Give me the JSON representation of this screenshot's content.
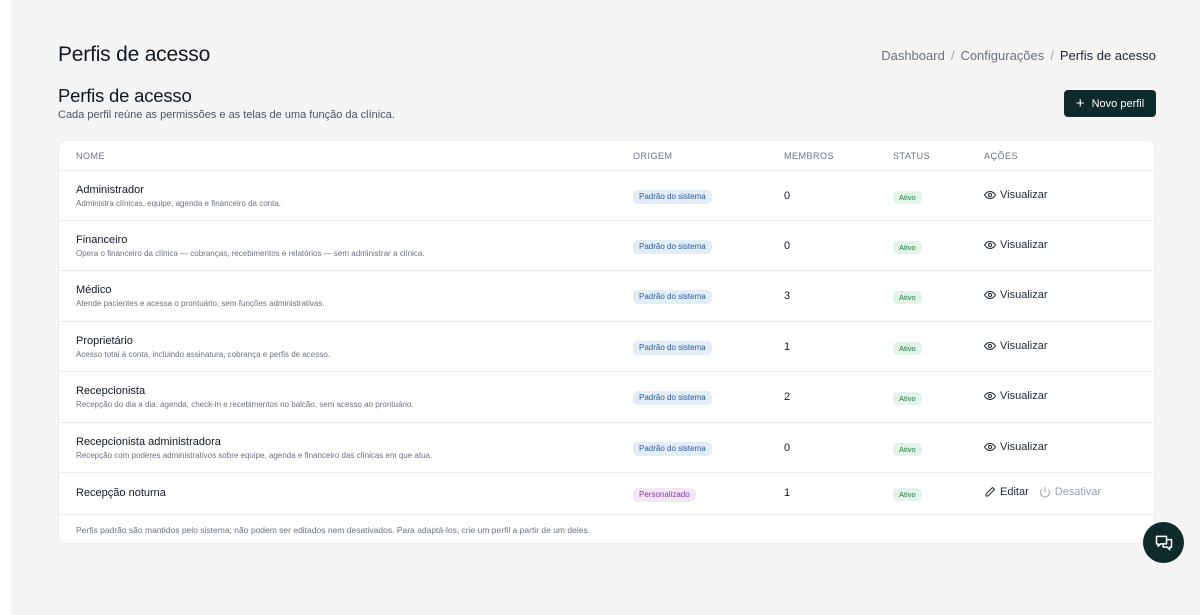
{
  "header": {
    "page_title": "Perfis de acesso",
    "breadcrumb": [
      "Dashboard",
      "Configurações",
      "Perfis de acesso"
    ]
  },
  "section": {
    "title": "Perfis de acesso",
    "subtitle": "Cada perfil reúne as permissões e as telas de uma função da clínica.",
    "new_button_label": "Novo perfil"
  },
  "table": {
    "columns": [
      "NOME",
      "ORIGEM",
      "MEMBROS",
      "STATUS",
      "AÇÕES"
    ],
    "rows": [
      {
        "name": "Administrador",
        "description": "Administra clínicas, equipe, agenda e financeiro da conta.",
        "origin": "Padrão do sistema",
        "members": "0",
        "status": "Ativo",
        "action": "Visualizar"
      },
      {
        "name": "Financeiro",
        "description": "Opera o financeiro da clínica — cobranças, recebimentos e relatórios — sem administrar a clínica.",
        "origin": "Padrão do sistema",
        "members": "0",
        "status": "Ativo",
        "action": "Visualizar"
      },
      {
        "name": "Médico",
        "description": "Atende pacientes e acessa o prontuário, sem funções administrativas.",
        "origin": "Padrão do sistema",
        "members": "3",
        "status": "Ativo",
        "action": "Visualizar"
      },
      {
        "name": "Proprietário",
        "description": "Acesso total à conta, incluindo assinatura, cobrança e perfis de acesso.",
        "origin": "Padrão do sistema",
        "members": "1",
        "status": "Ativo",
        "action": "Visualizar"
      },
      {
        "name": "Recepcionista",
        "description": "Recepção do dia a dia: agenda, check-in e recebimentos no balcão, sem acesso ao prontuário.",
        "origin": "Padrão do sistema",
        "members": "2",
        "status": "Ativo",
        "action": "Visualizar"
      },
      {
        "name": "Recepcionista administradora",
        "description": "Recepção com poderes administrativos sobre equipe, agenda e financeiro das clínicas em que atua.",
        "origin": "Padrão do sistema",
        "members": "0",
        "status": "Ativo",
        "action": "Visualizar"
      },
      {
        "name": "Recepção noturna",
        "origin": "Personalizado",
        "members": "1",
        "status": "Ativo",
        "edit_action": "Editar",
        "deactivate_action": "Desativar"
      }
    ],
    "footnote": "Perfis padrão são mantidos pelo sistema; não podem ser editados nem desativados. Para adaptá-los, crie um perfil a partir de um deles."
  },
  "icons": {
    "view": "eye-icon",
    "edit": "pencil-icon",
    "deactivate": "power-icon",
    "add": "plus-icon",
    "chat": "chat-icon"
  },
  "colors": {
    "primary": "#0f2a2a",
    "badge_system_bg": "#e3edf8",
    "badge_custom_bg": "#f3e6f7",
    "status_active_bg": "#e2f4e8"
  }
}
